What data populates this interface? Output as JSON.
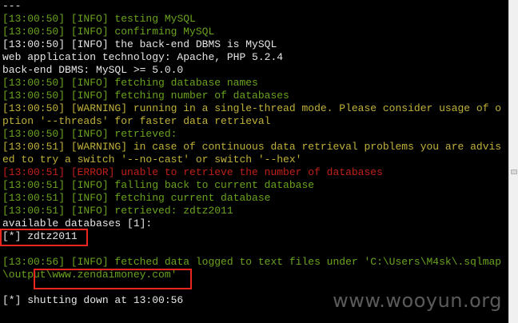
{
  "terminal": {
    "lines": [
      {
        "ts": "",
        "text": "---",
        "cls": "white"
      },
      {
        "ts": "[13:00:50]",
        "text": " [INFO] testing MySQL",
        "cls": "green"
      },
      {
        "ts": "[13:00:50]",
        "text": " [INFO] confirming MySQL",
        "cls": "green"
      },
      {
        "ts": "[13:00:50]",
        "text": " [INFO] the back-end DBMS is MySQL",
        "cls": "white"
      },
      {
        "ts": "",
        "text": "web application technology: Apache, PHP 5.2.4",
        "cls": "white"
      },
      {
        "ts": "",
        "text": "back-end DBMS: MySQL >= 5.0.0",
        "cls": "white"
      },
      {
        "ts": "[13:00:50]",
        "text": " [INFO] fetching database names",
        "cls": "green"
      },
      {
        "ts": "[13:00:50]",
        "text": " [INFO] fetching number of databases",
        "cls": "green"
      },
      {
        "ts": "[13:00:50]",
        "text": " [WARNING] running in a single-thread mode. Please consider usage of o",
        "cls": "yellow"
      },
      {
        "ts": "",
        "text": "ption '--threads' for faster data retrieval",
        "cls": "yellow"
      },
      {
        "ts": "[13:00:50]",
        "text": " [INFO] retrieved:",
        "cls": "green"
      },
      {
        "ts": "[13:00:51]",
        "text": " [WARNING] in case of continuous data retrieval problems you are advis",
        "cls": "yellow"
      },
      {
        "ts": "",
        "text": "ed to try a switch '--no-cast' or switch '--hex'",
        "cls": "yellow"
      },
      {
        "ts": "[13:00:51]",
        "text": " [ERROR] unable to retrieve the number of databases",
        "cls": "red"
      },
      {
        "ts": "[13:00:51]",
        "text": " [INFO] falling back to current database",
        "cls": "green"
      },
      {
        "ts": "[13:00:51]",
        "text": " [INFO] fetching current database",
        "cls": "green"
      },
      {
        "ts": "[13:00:51]",
        "text": " [INFO] retrieved: zdtz2011",
        "cls": "green"
      },
      {
        "ts": "",
        "text": "available databases [1]:",
        "cls": "white"
      },
      {
        "ts": "",
        "text": "[*] zdtz2011",
        "cls": "white"
      },
      {
        "ts": "",
        "text": "",
        "cls": "white"
      },
      {
        "ts": "[13:00:56]",
        "text": " [INFO] fetched data logged to text files under 'C:\\Users\\M4sk\\.sqlmap",
        "cls": "green"
      },
      {
        "ts": "",
        "text": "\\output\\www.zendaimoney.com'",
        "cls": "green"
      },
      {
        "ts": "",
        "text": "",
        "cls": "white"
      },
      {
        "ts": "",
        "text": "[*] shutting down at 13:00:56",
        "cls": "white"
      }
    ]
  },
  "watermark": "www.wooyun.org",
  "colors": {
    "background": "#000000",
    "info": "#6aa31f",
    "warning": "#c0b13a",
    "error": "#c0201a",
    "plain": "#e6e6e6",
    "highlight": "#e8251e"
  }
}
